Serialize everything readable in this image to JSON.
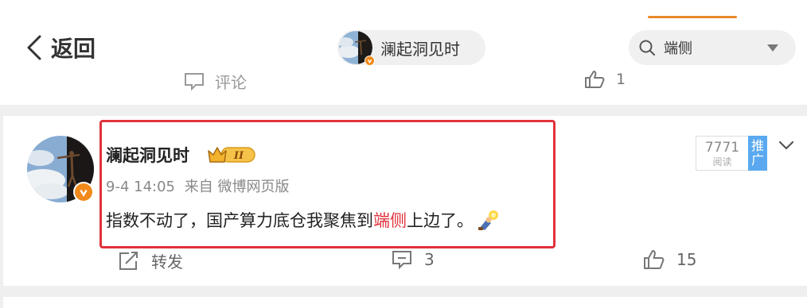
{
  "header": {
    "back_label": "返回",
    "author_pill_name": "澜起洞见时",
    "search_value": "端侧"
  },
  "previous_post": {
    "comment_label": "评论",
    "like_count": "1"
  },
  "post": {
    "author": "澜起洞见时",
    "vip_level": "II",
    "timestamp": "9-4 14:05",
    "source": "来自 微博网页版",
    "text_before": "指数不动了，国产算力底仓我聚焦到",
    "keyword": "端侧",
    "text_after": "上边了。",
    "read_count": "7771",
    "read_label": "阅读",
    "promote_label": "推广",
    "repost_label": "转发",
    "comment_count": "3",
    "like_count": "15"
  },
  "colors": {
    "accent_orange": "#e88a2a",
    "highlight_red": "#e0323c",
    "promote_blue": "#5aa9f0",
    "verified_orange": "#f08a1c"
  },
  "icons": [
    "back-chevron-icon",
    "search-icon",
    "dropdown-caret-icon",
    "verified-badge-icon",
    "vip-crown-icon",
    "emoji-icon",
    "more-chevron-icon",
    "repost-icon",
    "comment-icon",
    "like-icon"
  ]
}
